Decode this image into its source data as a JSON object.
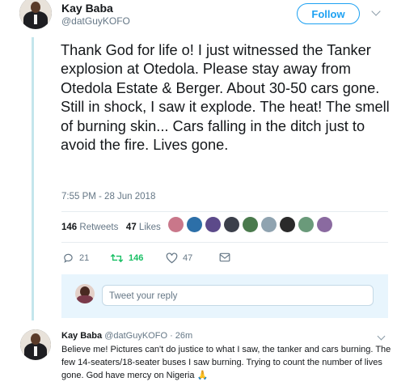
{
  "tweet": {
    "author_name": "Kay Baba",
    "author_handle": "@datGuyKOFO",
    "follow_label": "Follow",
    "text": "Thank God for life o! I just witnessed the Tanker explosion at Otedola. Please stay away from Otedola Estate & Berger. About 30-50 cars gone. Still in shock, I saw it explode. The heat! The smell of burning skin... Cars falling in the ditch just to avoid the fire. Lives gone.",
    "timestamp": "7:55 PM - 28 Jun 2018",
    "retweets_count": "146",
    "retweets_label": "Retweets",
    "likes_count": "47",
    "likes_label": "Likes",
    "liker_colors": [
      "#c9778a",
      "#2c6fa8",
      "#5c4a8a",
      "#3b3f4a",
      "#4a7a4d",
      "#8fa3b0",
      "#2a2a2a",
      "#6a9a7a",
      "#8a6aa0"
    ]
  },
  "actions": {
    "reply_count": "21",
    "retweet_count": "146",
    "like_count": "47",
    "retweet_color": "#17bf63",
    "icon_color": "#657786"
  },
  "reply_composer": {
    "placeholder": "Tweet your reply"
  },
  "reply": {
    "author_name": "Kay Baba",
    "author_handle": "@datGuyKOFO",
    "time": "· 26m",
    "text": "Believe me! Pictures can't do justice to what I saw, the tanker and cars burning. The few 14-seaters/18-seater buses I saw burning. Trying to count the number of lives gone. God have mercy on Nigeria 🙏"
  }
}
